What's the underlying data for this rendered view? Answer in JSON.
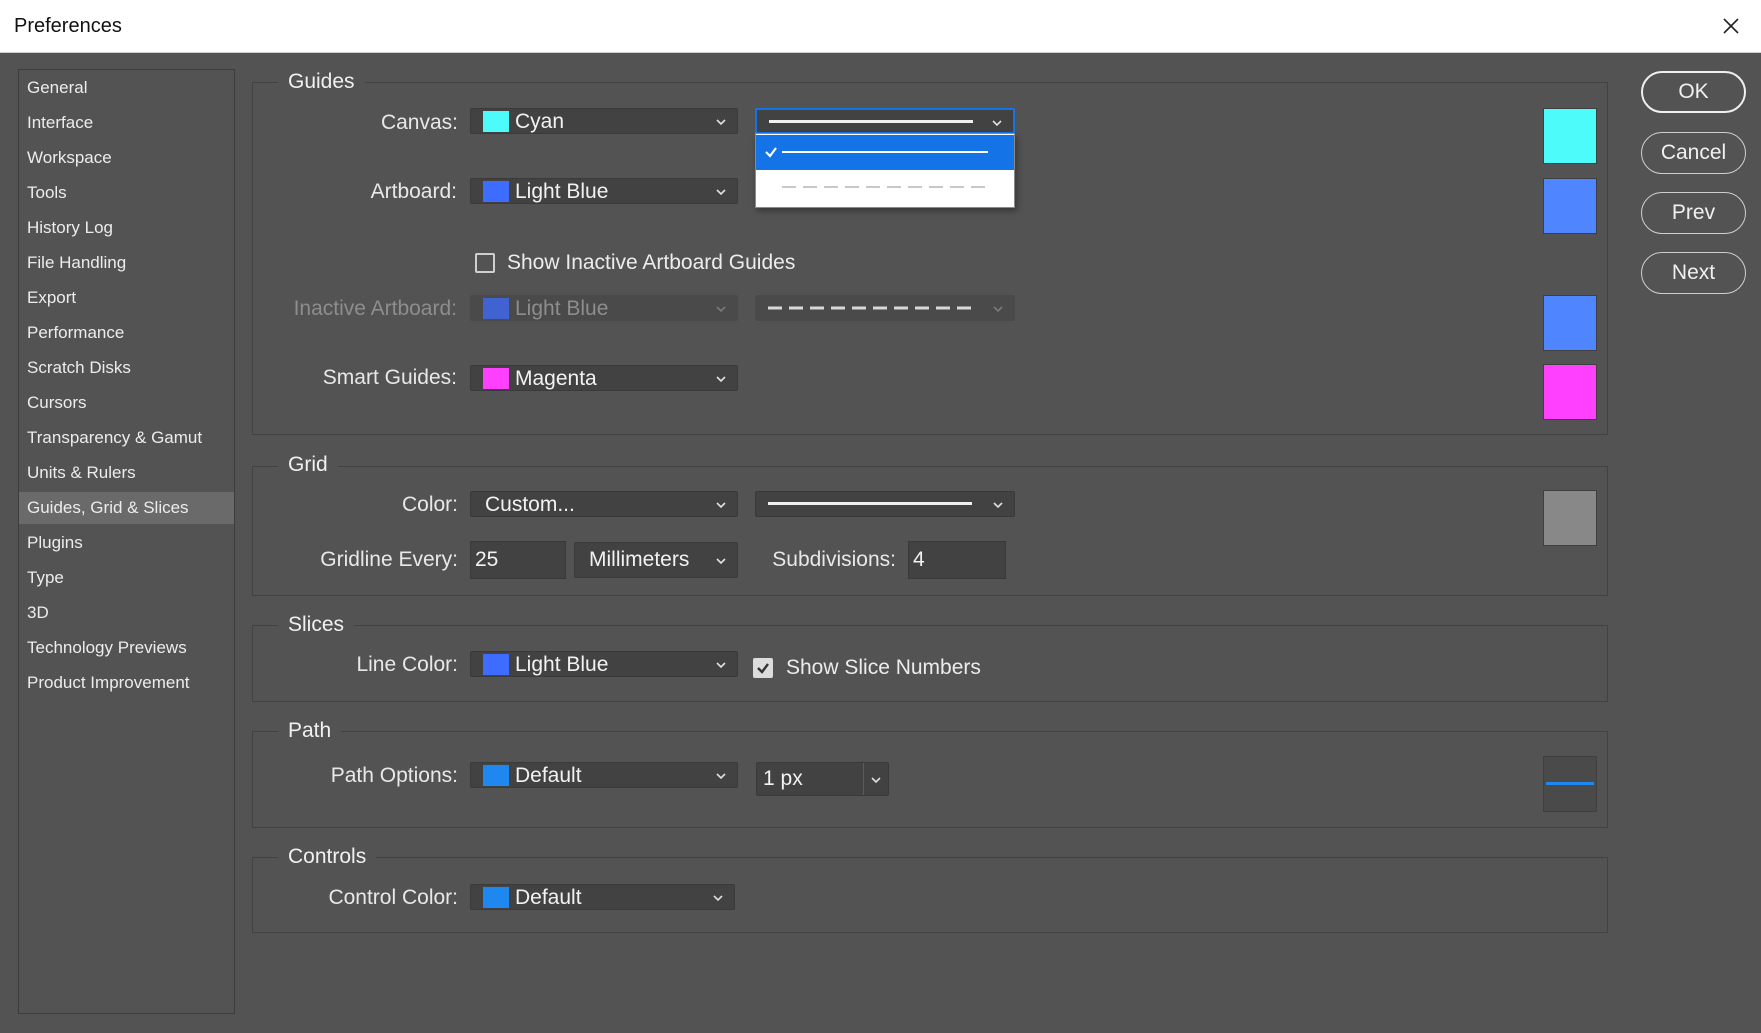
{
  "window": {
    "title": "Preferences"
  },
  "sidebar": {
    "items": [
      {
        "label": "General"
      },
      {
        "label": "Interface"
      },
      {
        "label": "Workspace"
      },
      {
        "label": "Tools"
      },
      {
        "label": "History Log"
      },
      {
        "label": "File Handling"
      },
      {
        "label": "Export"
      },
      {
        "label": "Performance"
      },
      {
        "label": "Scratch Disks"
      },
      {
        "label": "Cursors"
      },
      {
        "label": "Transparency & Gamut"
      },
      {
        "label": "Units & Rulers"
      },
      {
        "label": "Guides, Grid & Slices"
      },
      {
        "label": "Plugins"
      },
      {
        "label": "Type"
      },
      {
        "label": "3D"
      },
      {
        "label": "Technology Previews"
      },
      {
        "label": "Product Improvement"
      }
    ],
    "selected": "Guides, Grid & Slices"
  },
  "guides": {
    "title": "Guides",
    "canvas": {
      "label": "Canvas:",
      "color": "Cyan",
      "swatch": "#4dfbfb",
      "style": "solid",
      "style_options": [
        "solid",
        "dashed"
      ],
      "style_selected": "solid"
    },
    "artboard": {
      "label": "Artboard:",
      "color": "Light Blue",
      "swatch": "#3d6cff"
    },
    "show_inactive": {
      "label": "Show Inactive Artboard Guides",
      "checked": false
    },
    "inactive_artboard": {
      "label": "Inactive Artboard:",
      "color": "Light Blue",
      "swatch": "#3d6cff",
      "style": "dashed",
      "disabled": true
    },
    "smart_guides": {
      "label": "Smart Guides:",
      "color": "Magenta",
      "swatch": "#ff40ff"
    },
    "preview_swatches": [
      "#4dfbfb",
      "#4f86ff",
      "#4f86ff",
      "#ff40ff"
    ]
  },
  "grid": {
    "title": "Grid",
    "color": {
      "label": "Color:",
      "value": "Custom...",
      "style": "solid"
    },
    "gridline": {
      "label": "Gridline Every:",
      "value": "25",
      "unit": "Millimeters"
    },
    "subdivisions": {
      "label": "Subdivisions:",
      "value": "4"
    },
    "preview_swatch": "#888888"
  },
  "slices": {
    "title": "Slices",
    "line_color": {
      "label": "Line Color:",
      "color": "Light Blue",
      "swatch": "#3d6cff"
    },
    "show_numbers": {
      "label": "Show Slice Numbers",
      "checked": true
    }
  },
  "path": {
    "title": "Path",
    "options": {
      "label": "Path Options:",
      "color": "Default",
      "swatch": "#1e88f0",
      "width": "1 px"
    }
  },
  "controls": {
    "title": "Controls",
    "color": {
      "label": "Control Color:",
      "value": "Default",
      "swatch": "#1e88f0"
    }
  },
  "buttons": {
    "ok": "OK",
    "cancel": "Cancel",
    "prev": "Prev",
    "next": "Next"
  },
  "icons": {
    "close": "close-icon",
    "chevron": "chevron-down-icon",
    "check": "checkmark-icon"
  }
}
